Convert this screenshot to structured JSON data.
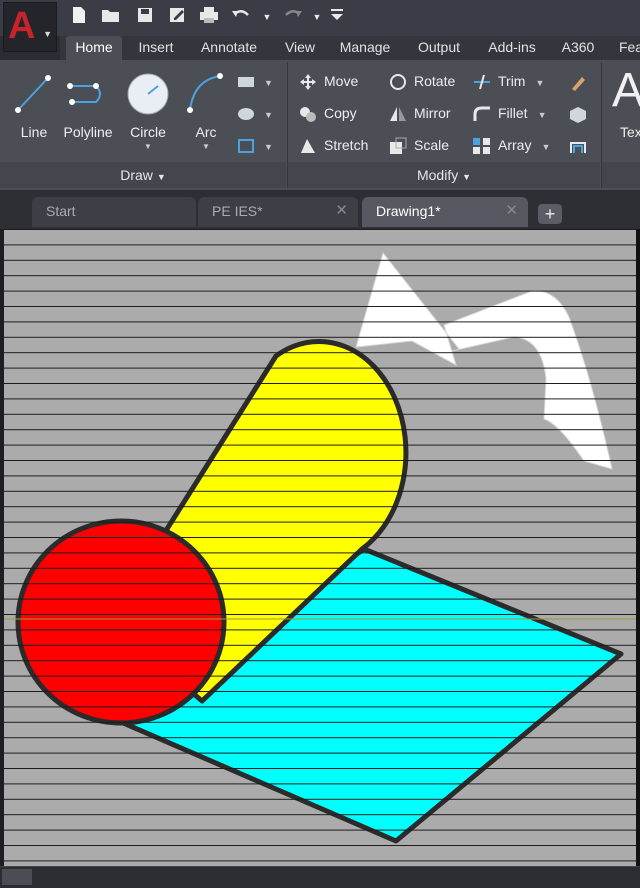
{
  "app": {
    "logo_letter": "A"
  },
  "quick_access": {
    "icons": [
      "new-icon",
      "open-icon",
      "save-icon",
      "save-as-icon",
      "plot-icon",
      "undo-icon",
      "redo-icon",
      "customize-icon"
    ]
  },
  "ribbon_tabs": [
    {
      "label": "Home",
      "active": true
    },
    {
      "label": "Insert"
    },
    {
      "label": "Annotate"
    },
    {
      "label": "View"
    },
    {
      "label": "Manage"
    },
    {
      "label": "Output"
    },
    {
      "label": "Add-ins"
    },
    {
      "label": "A360"
    },
    {
      "label": "Fea"
    }
  ],
  "draw_panel": {
    "title": "Draw",
    "tools": [
      "Line",
      "Polyline",
      "Circle",
      "Arc"
    ]
  },
  "modify_panel": {
    "title": "Modify",
    "tools": [
      {
        "label": "Move"
      },
      {
        "label": "Rotate"
      },
      {
        "label": "Trim"
      },
      {
        "label": "Copy"
      },
      {
        "label": "Mirror"
      },
      {
        "label": "Fillet"
      },
      {
        "label": "Stretch"
      },
      {
        "label": "Scale"
      },
      {
        "label": "Array"
      }
    ]
  },
  "annotation_panel": {
    "big_letter": "A",
    "label": "Tex"
  },
  "doc_tabs": [
    {
      "label": "Start"
    },
    {
      "label": "PE IES*"
    },
    {
      "label": "Drawing1*",
      "active": true
    }
  ],
  "colors": {
    "cylinder_body": "#ffff00",
    "cylinder_end": "#ff0000",
    "sheet": "#00ffff",
    "arrow": "#ffffff",
    "outline": "#2b2b2b",
    "background": "#ababab"
  }
}
